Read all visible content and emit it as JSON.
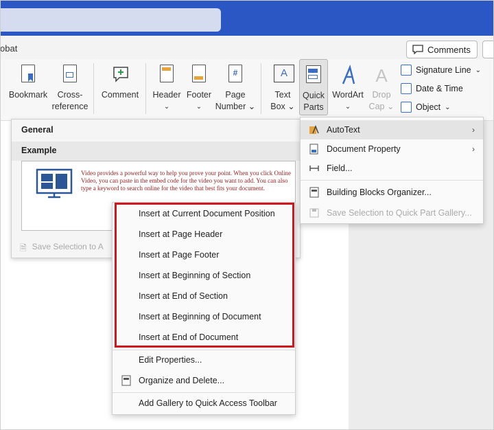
{
  "tabs": {
    "acrobat": "obat"
  },
  "header": {
    "comments_label": "Comments"
  },
  "ribbon": {
    "bookmark": "Bookmark",
    "cross_ref_1": "Cross-",
    "cross_ref_2": "reference",
    "comment": "Comment",
    "header": "Header",
    "footer": "Footer",
    "page_number_1": "Page",
    "page_number_2": "Number",
    "text_box_1": "Text",
    "text_box_2": "Box",
    "quick_parts_1": "Quick",
    "quick_parts_2": "Parts",
    "wordart": "WordArt",
    "drop_cap_1": "Drop",
    "drop_cap_2": "Cap",
    "signature_line": "Signature Line",
    "date_time": "Date & Time",
    "object": "Object"
  },
  "gallery": {
    "general": "General",
    "example": "Example",
    "example_text": "Video provides a powerful way to help you prove your point. When you click Online Video, you can paste in the embed code for the video you want to add. You can also type a keyword to search online for the video that best fits your document.",
    "save_selection": "Save Selection to A"
  },
  "quick_parts_menu": {
    "items": [
      {
        "label": "AutoText"
      },
      {
        "label": "Document Property"
      },
      {
        "label": "Field..."
      },
      {
        "label": "Building Blocks Organizer..."
      },
      {
        "label": "Save Selection to Quick Part Gallery..."
      }
    ]
  },
  "context_menu": {
    "items": [
      {
        "label": "Insert at Current Document Position"
      },
      {
        "label": "Insert at Page Header"
      },
      {
        "label": "Insert at Page Footer"
      },
      {
        "label": "Insert at Beginning of Section"
      },
      {
        "label": "Insert at End of Section"
      },
      {
        "label": "Insert at Beginning of Document"
      },
      {
        "label": "Insert at End of Document"
      },
      {
        "label": "Edit Properties..."
      },
      {
        "label": "Organize and Delete..."
      },
      {
        "label": "Add Gallery to Quick Access Toolbar"
      }
    ]
  },
  "colors": {
    "title_bar": "#2b57c5",
    "highlight_box": "#d0171e",
    "example_text": "#9b1d1d"
  }
}
